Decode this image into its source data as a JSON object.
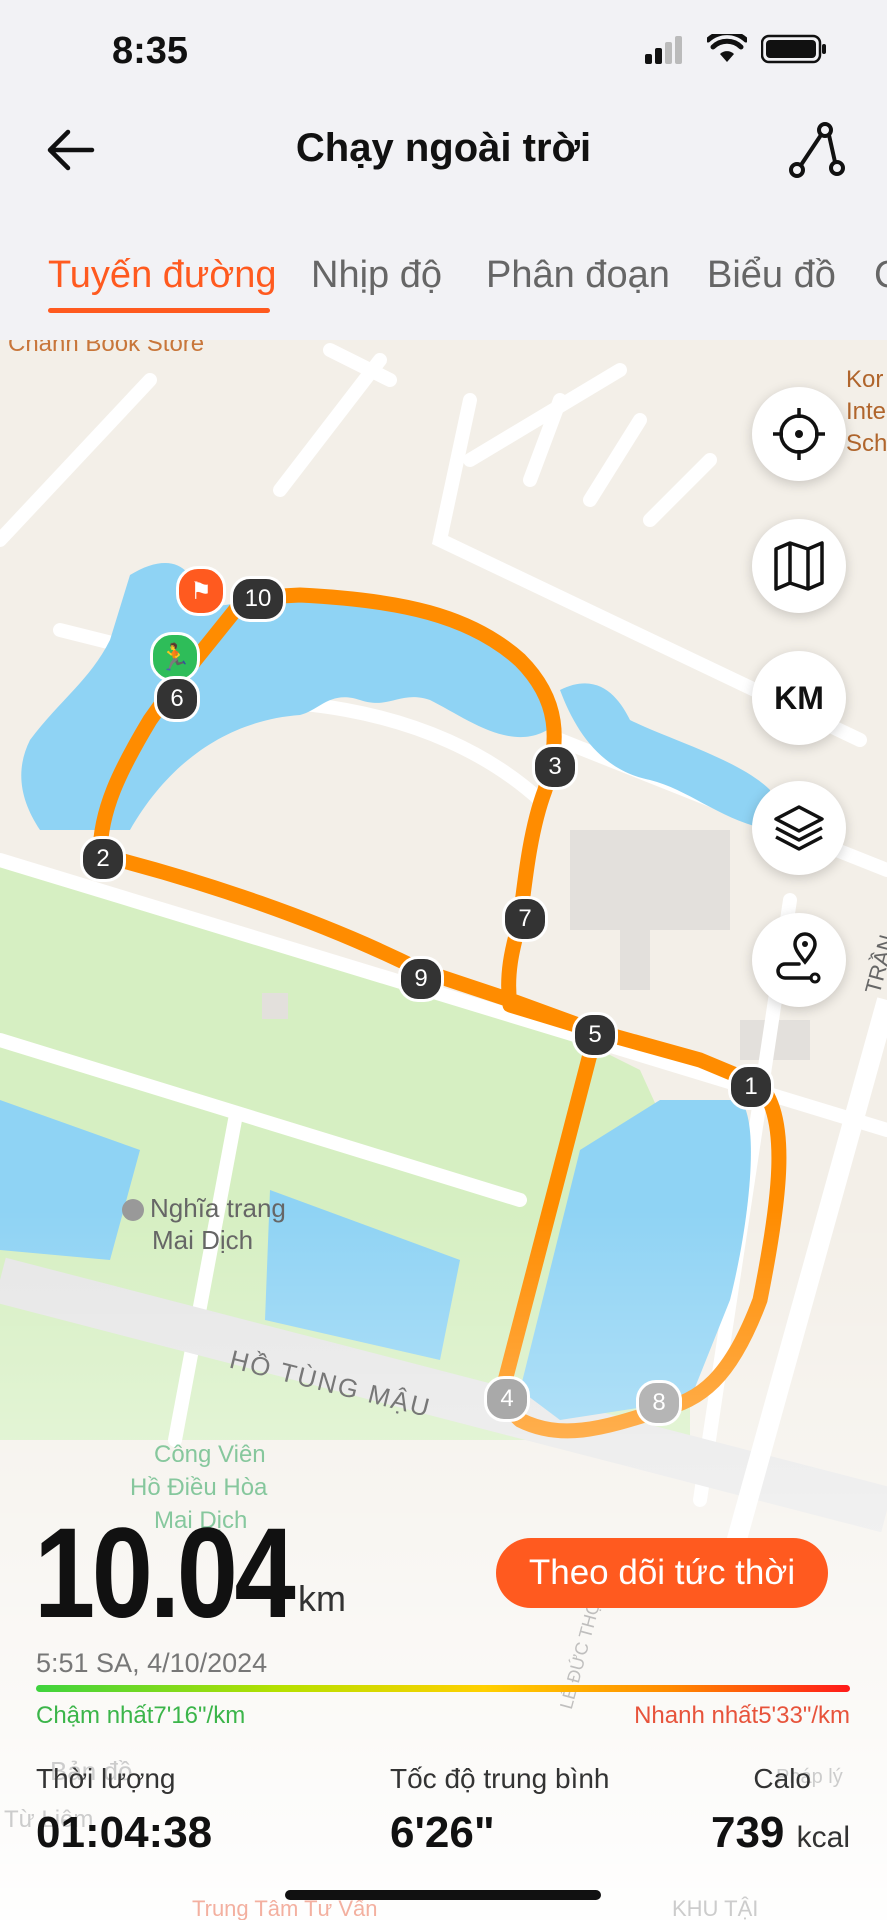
{
  "status_bar": {
    "time": "8:35"
  },
  "header": {
    "title": "Chạy ngoài trời"
  },
  "tabs": [
    {
      "label": "Tuyến đường",
      "active": true
    },
    {
      "label": "Nhịp độ",
      "active": false
    },
    {
      "label": "Phân đoạn",
      "active": false
    },
    {
      "label": "Biểu đồ",
      "active": false
    },
    {
      "label": "C",
      "active": false
    }
  ],
  "map": {
    "labels": {
      "store": "Chanh Book Store",
      "school": "Kor Inte Sch",
      "cemetery_1": "Nghĩa trang",
      "cemetery_2": "Mai Dịch",
      "street": "HỒ TÙNG MẬU",
      "street_right": "TRẦN",
      "park_1": "Công Viên",
      "park_2": "Hồ Điều Hòa",
      "park_3": "Mai Dịch",
      "map_brand": "Bản đồ",
      "district": "Từ Liêm",
      "legal": "Pháp lý",
      "bottom_1": "Trung Tâm Tư Vấn",
      "bottom_2": "KHU TẬI",
      "road_diag": "LÊ ĐỨC THỌ"
    },
    "km_markers": [
      "1",
      "2",
      "3",
      "4",
      "5",
      "6",
      "7",
      "8",
      "9",
      "10"
    ],
    "controls": {
      "locate": "crosshair-icon",
      "map_type": "map-icon",
      "units": "KM",
      "layers": "layers-icon",
      "route_pin": "route-pin-icon"
    }
  },
  "summary": {
    "distance": "10.04",
    "distance_unit": "km",
    "live_button": "Theo dõi tức thời",
    "datetime": "5:51 SA, 4/10/2024",
    "slowest": "Chậm nhất7'16\"/km",
    "fastest": "Nhanh nhất5'33\"/km",
    "stats": [
      {
        "label": "Thời lượng",
        "value": "01:04:38",
        "unit": ""
      },
      {
        "label": "Tốc độ trung bình",
        "value": "6'26\"",
        "unit": ""
      },
      {
        "label": "Calo",
        "value": "739",
        "unit": "kcal"
      }
    ]
  },
  "colors": {
    "accent": "#ff5a1f",
    "route": "#ff8c00",
    "water": "#8fd3f4",
    "park": "#d6efc2"
  }
}
